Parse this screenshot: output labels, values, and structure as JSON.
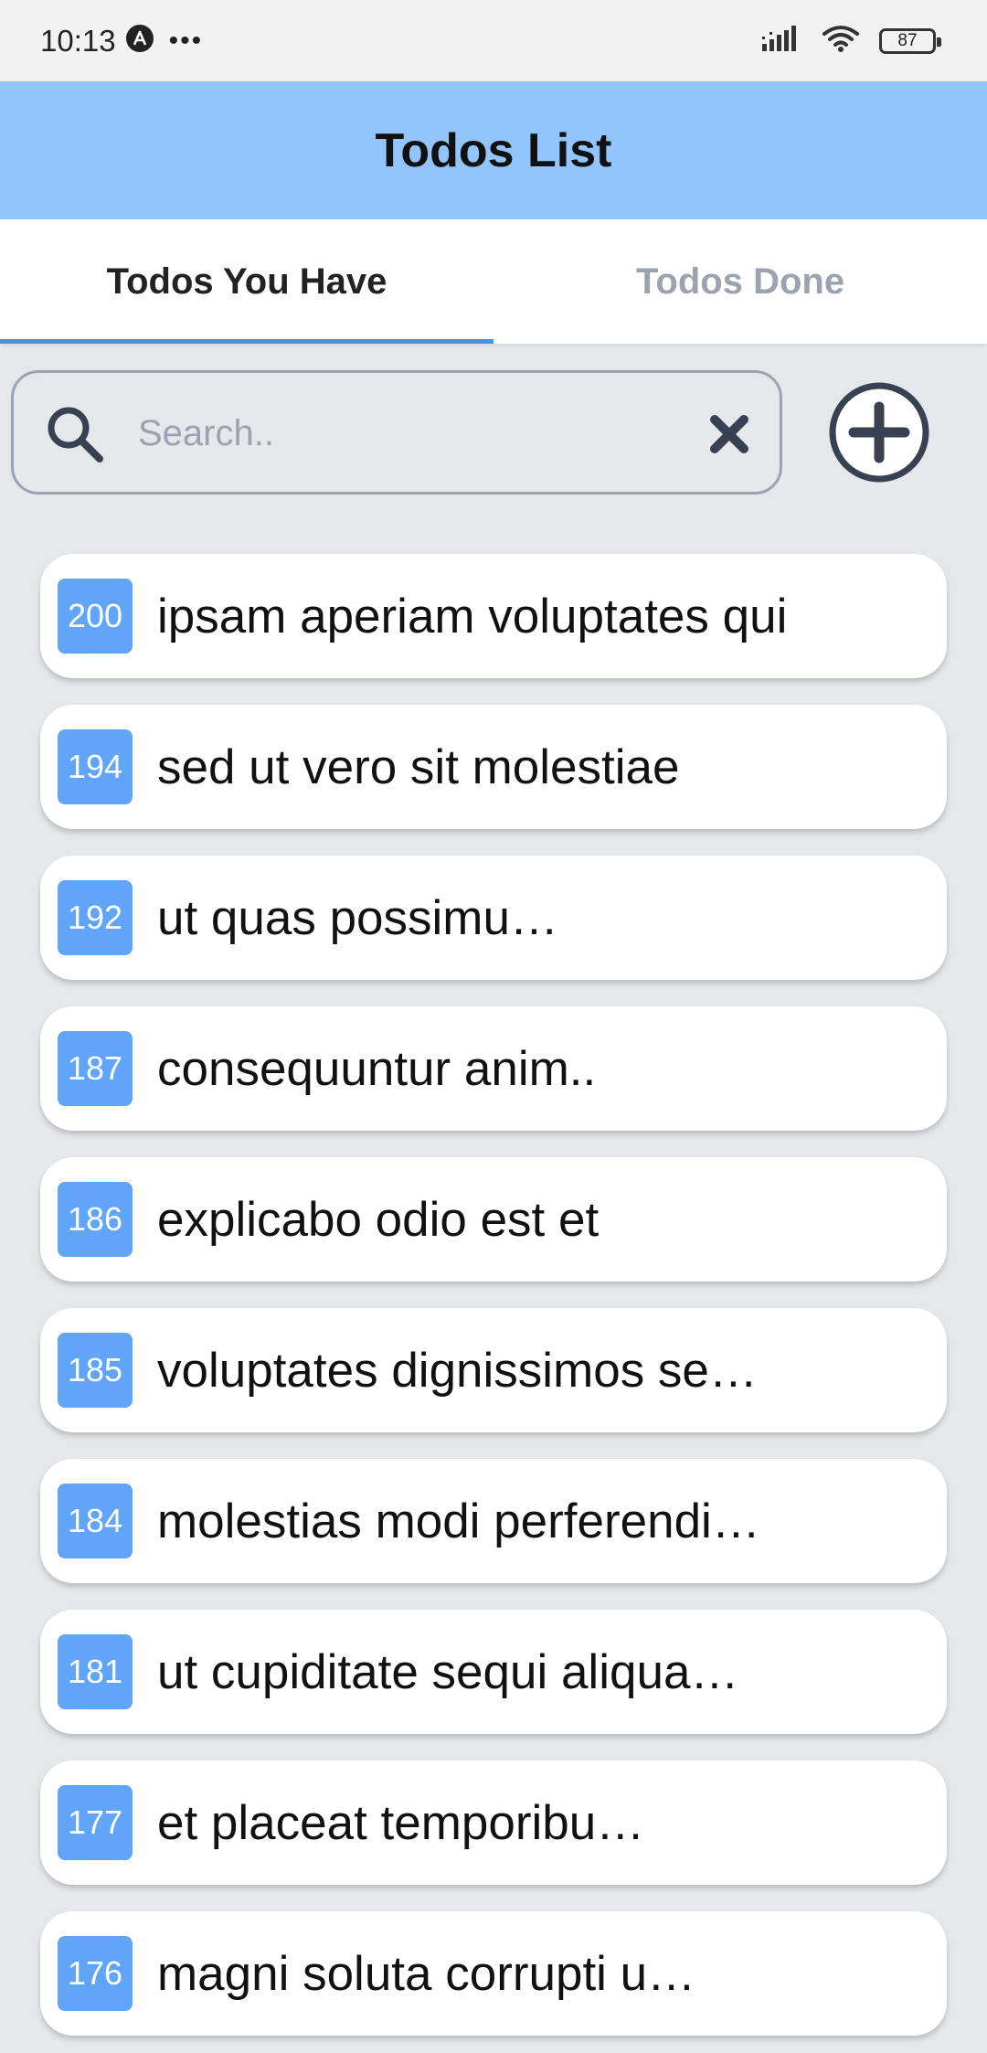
{
  "status_bar": {
    "time": "10:13",
    "notification_icon": "a-circle-icon",
    "more": "•••",
    "battery": "87"
  },
  "header": {
    "title": "Todos List"
  },
  "tabs": [
    {
      "label": "Todos You Have",
      "active": true
    },
    {
      "label": "Todos Done",
      "active": false
    }
  ],
  "search": {
    "placeholder": "Search..",
    "value": ""
  },
  "todos": [
    {
      "id": "200",
      "title": "ipsam aperiam voluptates qui"
    },
    {
      "id": "194",
      "title": "sed ut vero sit molestiae"
    },
    {
      "id": "192",
      "title": "ut quas possimu…"
    },
    {
      "id": "187",
      "title": "consequuntur anim.."
    },
    {
      "id": "186",
      "title": "explicabo odio est et"
    },
    {
      "id": "185",
      "title": "voluptates dignissimos se…"
    },
    {
      "id": "184",
      "title": "molestias modi perferendi…"
    },
    {
      "id": "181",
      "title": "ut cupiditate sequi aliqua…"
    },
    {
      "id": "177",
      "title": "et placeat temporibu…"
    },
    {
      "id": "176",
      "title": "magni soluta corrupti u…"
    }
  ],
  "colors": {
    "header_bg": "#93c5fd",
    "id_badge": "#60a5fa",
    "tab_indicator": "#4a90e2",
    "background": "#e5e7eb"
  }
}
